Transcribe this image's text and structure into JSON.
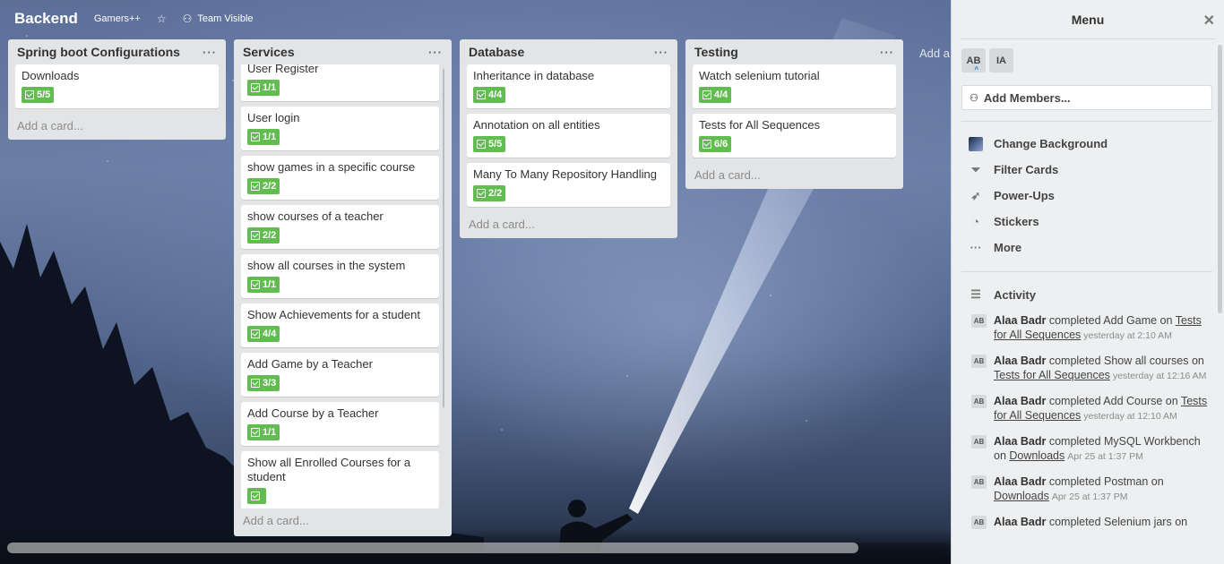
{
  "board": {
    "title": "Backend",
    "team": "Gamers++",
    "visibility": "Team Visible",
    "add_list": "Add a"
  },
  "lists": [
    {
      "title": "Spring boot Configurations",
      "cards": [
        {
          "title": "Downloads",
          "badge": "5/5"
        }
      ],
      "add_card": "Add a card..."
    },
    {
      "title": "Services",
      "cards": [
        {
          "title": "User Register",
          "badge": "1/1"
        },
        {
          "title": "User login",
          "badge": "1/1"
        },
        {
          "title": "show games in a specific course",
          "badge": "2/2"
        },
        {
          "title": "show courses of a teacher",
          "badge": "2/2"
        },
        {
          "title": "show all courses in the system",
          "badge": "1/1"
        },
        {
          "title": "Show Achievements for a student",
          "badge": "4/4"
        },
        {
          "title": "Add Game by a Teacher",
          "badge": "3/3"
        },
        {
          "title": "Add Course by a Teacher",
          "badge": "1/1"
        },
        {
          "title": "Show all Enrolled Courses for a student",
          "badge": ""
        }
      ],
      "add_card": "Add a card..."
    },
    {
      "title": "Database",
      "cards": [
        {
          "title": "Inheritance in database",
          "badge": "4/4"
        },
        {
          "title": "Annotation on all entities",
          "badge": "5/5"
        },
        {
          "title": "Many To Many Repository Handling",
          "badge": "2/2"
        }
      ],
      "add_card": "Add a card..."
    },
    {
      "title": "Testing",
      "cards": [
        {
          "title": "Watch selenium tutorial",
          "badge": "4/4"
        },
        {
          "title": "Tests for All Sequences",
          "badge": "6/6"
        }
      ],
      "add_card": "Add a card..."
    }
  ],
  "menu": {
    "title": "Menu",
    "members": [
      "AB",
      "IA"
    ],
    "add_members": "Add Members...",
    "items": [
      "Change Background",
      "Filter Cards",
      "Power-Ups",
      "Stickers",
      "More"
    ],
    "activity_title": "Activity",
    "activity": [
      {
        "user": "Alaa Badr",
        "text": "completed Add Game on",
        "link": "Tests for All Sequences",
        "time": "yesterday at 2:10 AM"
      },
      {
        "user": "Alaa Badr",
        "text": "completed Show all courses on",
        "link": "Tests for All Sequences",
        "time": "yesterday at 12:16 AM"
      },
      {
        "user": "Alaa Badr",
        "text": "completed Add Course on",
        "link": "Tests for All Sequences",
        "time": "yesterday at 12:10 AM"
      },
      {
        "user": "Alaa Badr",
        "text": "completed MySQL Workbench on",
        "link": "Downloads",
        "time": "Apr 25 at 1:37 PM"
      },
      {
        "user": "Alaa Badr",
        "text": "completed Postman on",
        "link": "Downloads",
        "time": "Apr 25 at 1:37 PM"
      },
      {
        "user": "Alaa Badr",
        "text": "completed Selenium jars on",
        "link": "",
        "time": ""
      }
    ]
  },
  "colors": {
    "badge_green": "#61bd4f",
    "list_bg": "#e2e4e6",
    "menu_bg": "#edeff0"
  }
}
